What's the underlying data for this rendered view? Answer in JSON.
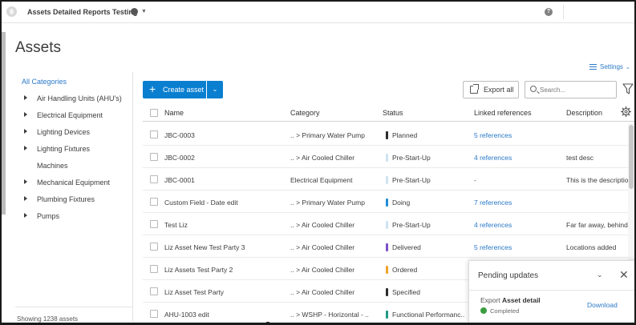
{
  "topbar": {
    "project_title": "Assets Detailed Reports Testing",
    "help_label": "?"
  },
  "page": {
    "title": "Assets",
    "settings_label": "Settings"
  },
  "categories": {
    "all_label": "All Categories",
    "items": [
      {
        "label": "Air Handling Units (AHU's)",
        "expandable": true
      },
      {
        "label": "Electrical Equipment",
        "expandable": true
      },
      {
        "label": "Lighting Devices",
        "expandable": true
      },
      {
        "label": "Lighting Fixtures",
        "expandable": true
      },
      {
        "label": "Machines",
        "expandable": false
      },
      {
        "label": "Mechanical Equipment",
        "expandable": true
      },
      {
        "label": "Plumbing Fixtures",
        "expandable": true
      },
      {
        "label": "Pumps",
        "expandable": true
      }
    ],
    "footer": "Showing 1238 assets"
  },
  "toolbar": {
    "create_label": "Create asset",
    "export_label": "Export all",
    "search_placeholder": "Search..."
  },
  "table": {
    "columns": {
      "name": "Name",
      "category": "Category",
      "status": "Status",
      "links": "Linked references",
      "description": "Description"
    },
    "rows": [
      {
        "name": "JBC-0003",
        "category": ".. > Primary Water Pump",
        "status": "Planned",
        "status_color": "#2b2b2b",
        "links": "5 references",
        "description": ""
      },
      {
        "name": "JBC-0002",
        "category": ".. > Air Cooled Chiller",
        "status": "Pre-Start-Up",
        "status_color": "#cfe3f1",
        "links": "4 references",
        "description": "test desc"
      },
      {
        "name": "JBC-0001",
        "category": "Electrical Equipment",
        "status": "Pre-Start-Up",
        "status_color": "#cfe3f1",
        "links": "-",
        "description": "This is the description"
      },
      {
        "name": "Custom Field - Date edit",
        "category": ".. > Primary Water Pump",
        "status": "Doing",
        "status_color": "#1f8fd6",
        "links": "7 references",
        "description": ""
      },
      {
        "name": "Test Liz",
        "category": ".. > Air Cooled Chiller",
        "status": "Pre-Start-Up",
        "status_color": "#cfe3f1",
        "links": "4 references",
        "description": "Far far away, behind"
      },
      {
        "name": "Liz Asset New Test Party 3",
        "category": ".. > Air Cooled Chiller",
        "status": "Delivered",
        "status_color": "#7b4fc9",
        "links": "5 references",
        "description": "Locations added"
      },
      {
        "name": "Liz Assets Test Party 2",
        "category": ".. > Air Cooled Chiller",
        "status": "Ordered",
        "status_color": "#f0a328",
        "links": "",
        "description": ""
      },
      {
        "name": "Liz Asset Test Party",
        "category": ".. > Air Cooled Chiller",
        "status": "Specified",
        "status_color": "#2b2b2b",
        "links": "",
        "description": ""
      },
      {
        "name": "AHU-1003 edit",
        "category": ".. > WSHP - Horizontal - ..",
        "status": "Functional Performanc..",
        "status_color": "#1f9a84",
        "links": "",
        "description": ""
      }
    ]
  },
  "toast": {
    "title": "Pending updates",
    "message_prefix": "Export",
    "message_bold": "Asset detail",
    "status": "Completed",
    "action": "Download"
  }
}
